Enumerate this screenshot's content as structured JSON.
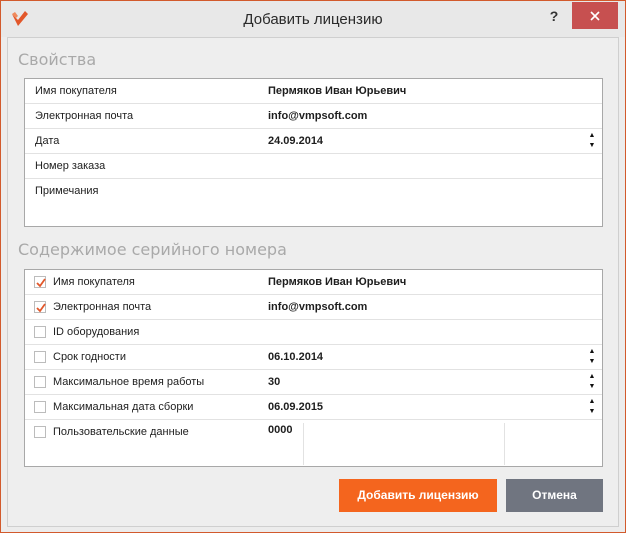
{
  "window": {
    "title": "Добавить лицензию",
    "help_label": "?"
  },
  "properties": {
    "section_title": "Свойства",
    "rows": [
      {
        "label": "Имя покупателя",
        "value": "Пермяков Иван Юрьевич"
      },
      {
        "label": "Электронная почта",
        "value": "info@vmpsoft.com"
      },
      {
        "label": "Дата",
        "value": "24.09.2014"
      },
      {
        "label": "Номер заказа",
        "value": ""
      },
      {
        "label": "Примечания",
        "value": ""
      }
    ]
  },
  "serial": {
    "section_title": "Содержимое серийного номера",
    "rows": [
      {
        "label": "Имя покупателя",
        "value": "Пермяков Иван Юрьевич",
        "checked": true
      },
      {
        "label": "Электронная почта",
        "value": "info@vmpsoft.com",
        "checked": true
      },
      {
        "label": "ID оборудования",
        "value": "",
        "checked": false
      },
      {
        "label": "Срок годности",
        "value": "06.10.2014",
        "checked": false
      },
      {
        "label": "Максимальное время работы",
        "value": "30",
        "checked": false
      },
      {
        "label": "Максимальная дата сборки",
        "value": "06.09.2015",
        "checked": false
      },
      {
        "label": "Пользовательские данные",
        "value": "0000",
        "checked": false
      }
    ]
  },
  "buttons": {
    "add_label": "Добавить лицензию",
    "cancel_label": "Отмена"
  },
  "colors": {
    "accent": "#f4651e",
    "close": "#c75050",
    "cancel": "#707580",
    "checkmark": "#e2572a"
  },
  "icons": {
    "app": "vmprotect-logo-icon",
    "close": "close-icon",
    "spin_up": "arrow-up-icon",
    "spin_down": "arrow-down-icon",
    "check": "checkmark-icon"
  }
}
